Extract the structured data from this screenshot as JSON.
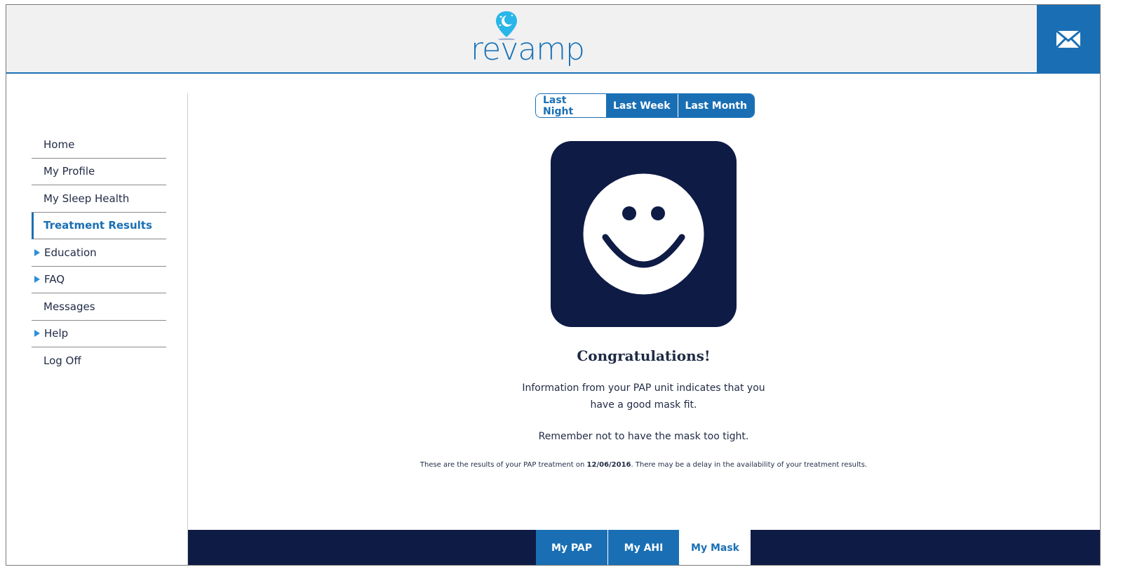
{
  "header": {
    "logo_text": "revamp",
    "mail_icon": "envelope-icon"
  },
  "sidebar": {
    "items": [
      {
        "label": "Home",
        "arrow": false,
        "active": false
      },
      {
        "label": "My Profile",
        "arrow": false,
        "active": false
      },
      {
        "label": "My Sleep Health",
        "arrow": false,
        "active": false
      },
      {
        "label": "Treatment Results",
        "arrow": false,
        "active": true
      },
      {
        "label": "Education",
        "arrow": true,
        "active": false
      },
      {
        "label": "FAQ",
        "arrow": true,
        "active": false
      },
      {
        "label": "Messages",
        "arrow": false,
        "active": false
      },
      {
        "label": "Help",
        "arrow": true,
        "active": false
      },
      {
        "label": "Log Off",
        "arrow": false,
        "active": false
      }
    ]
  },
  "period": {
    "options": [
      "Last Night",
      "Last Week",
      "Last Month"
    ],
    "selected": "Last Night"
  },
  "result": {
    "icon": "smiley-face-icon",
    "heading": "Congratulations!",
    "line1": "Information from your PAP unit indicates that you",
    "line2": "have a good mask fit.",
    "line3": "Remember not to have the mask too tight.",
    "note_prefix": "These are the results of your PAP treatment on ",
    "note_date": "12/06/2016",
    "note_suffix": ". There may be a delay in the availability of your treatment results."
  },
  "footer": {
    "tabs": [
      "My PAP",
      "My AHI",
      "My Mask"
    ],
    "selected": "My Mask"
  },
  "colors": {
    "primary_blue": "#1a6fb4",
    "navy": "#0e1b45",
    "header_bg": "#f1f1f1",
    "logo_accent": "#29b6e8"
  }
}
